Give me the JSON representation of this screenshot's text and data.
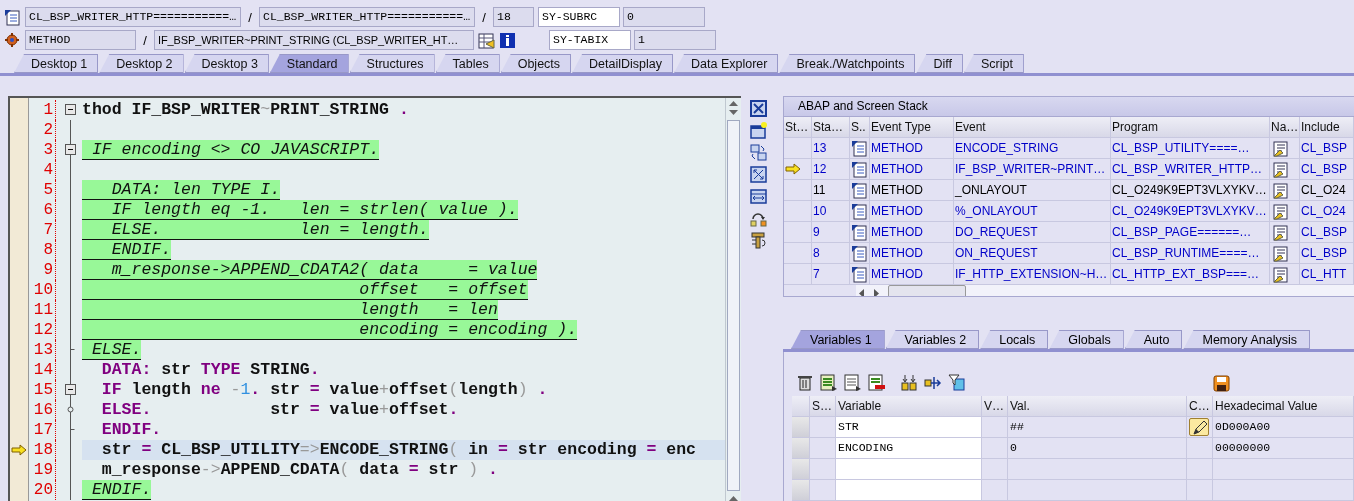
{
  "header": {
    "program": "CL_BSP_WRITER_HTTP===========…",
    "include": "CL_BSP_WRITER_HTTP===========…",
    "line": "18",
    "event_type": "METHOD",
    "event": "IF_BSP_WRITER~PRINT_STRING (CL_BSP_WRITER_HT…",
    "separators": [
      "/",
      "/",
      "/"
    ],
    "sy_fields": [
      {
        "name": "SY-SUBRC",
        "value": "0"
      },
      {
        "name": "SY-TABIX",
        "value": "1"
      }
    ]
  },
  "tabs": [
    {
      "label": "Desktop 1",
      "selected": false
    },
    {
      "label": "Desktop 2",
      "selected": false
    },
    {
      "label": "Desktop 3",
      "selected": false
    },
    {
      "label": "Standard",
      "selected": true
    },
    {
      "label": "Structures",
      "selected": false
    },
    {
      "label": "Tables",
      "selected": false
    },
    {
      "label": "Objects",
      "selected": false
    },
    {
      "label": "DetailDisplay",
      "selected": false
    },
    {
      "label": "Data Explorer",
      "selected": false
    },
    {
      "label": "Break./Watchpoints",
      "selected": false
    },
    {
      "label": "Diff",
      "selected": false
    },
    {
      "label": "Script",
      "selected": false
    }
  ],
  "editor": {
    "lines": [
      {
        "number": "1",
        "marker": {
          "kind": "toggle"
        },
        "highlight": false,
        "current": false,
        "segments": [
          {
            "text": "thod IF_BSP_WRITER",
            "kind": "plain"
          },
          {
            "text": "~",
            "kind": "operator"
          },
          {
            "text": "PRINT_STRING ",
            "kind": "plain"
          },
          {
            "text": ".",
            "kind": "punct"
          }
        ]
      },
      {
        "number": "2"
      },
      {
        "number": "3",
        "marker": {
          "kind": "toggle"
        },
        "highlight": true,
        "current": false,
        "segments": [
          {
            "text": " IF encoding <> CO JAVASCRIPT.",
            "kind": "plain"
          }
        ]
      },
      {
        "number": "4"
      },
      {
        "number": "5",
        "highlight": true,
        "current": false,
        "segments": [
          {
            "text": "   DATA: len TYPE I.",
            "kind": "plain"
          }
        ]
      },
      {
        "number": "6",
        "highlight": true,
        "current": false,
        "segments": [
          {
            "text": "   IF length eq -1.   len = strlen( value ).",
            "kind": "plain"
          }
        ]
      },
      {
        "number": "7",
        "highlight": true,
        "current": false,
        "segments": [
          {
            "text": "   ELSE.              len = length.",
            "kind": "plain"
          }
        ]
      },
      {
        "number": "8",
        "highlight": true,
        "current": false,
        "segments": [
          {
            "text": "   ENDIF.",
            "kind": "plain"
          }
        ]
      },
      {
        "number": "9",
        "highlight": true,
        "current": false,
        "segments": [
          {
            "text": "   m_response->APPEND_CDATA2( data     = value",
            "kind": "plain"
          }
        ]
      },
      {
        "number": "10",
        "highlight": true,
        "current": false,
        "segments": [
          {
            "text": "                            offset   = offset",
            "kind": "plain"
          }
        ]
      },
      {
        "number": "11",
        "highlight": true,
        "current": false,
        "segments": [
          {
            "text": "                            length   = len",
            "kind": "plain"
          }
        ]
      },
      {
        "number": "12",
        "highlight": true,
        "current": false,
        "segments": [
          {
            "text": "                            encoding = encoding ).",
            "kind": "plain"
          }
        ]
      },
      {
        "number": "13",
        "marker": {
          "kind": "end"
        },
        "highlight": true,
        "current": false,
        "segments": [
          {
            "text": " ELSE.",
            "kind": "plain"
          }
        ]
      },
      {
        "number": "14",
        "highlight": false,
        "current": false,
        "segments": [
          {
            "text": "  DATA:",
            "kind": "keyword"
          },
          {
            "text": " str ",
            "kind": "plain"
          },
          {
            "text": "TYPE",
            "kind": "keyword"
          },
          {
            "text": " STRING",
            "kind": "plain"
          },
          {
            "text": ".",
            "kind": "punct"
          }
        ]
      },
      {
        "number": "15",
        "marker": {
          "kind": "toggle"
        },
        "highlight": false,
        "current": false,
        "segments": [
          {
            "text": "  IF",
            "kind": "keyword"
          },
          {
            "text": " length ",
            "kind": "plain"
          },
          {
            "text": "ne",
            "kind": "keyword"
          },
          {
            "text": " -",
            "kind": "operator"
          },
          {
            "text": "1",
            "kind": "number"
          },
          {
            "text": ".",
            "kind": "punct"
          },
          {
            "text": " str ",
            "kind": "plain"
          },
          {
            "text": "=",
            "kind": "punct"
          },
          {
            "text": " value",
            "kind": "plain"
          },
          {
            "text": "+",
            "kind": "operator"
          },
          {
            "text": "offset",
            "kind": "plain"
          },
          {
            "text": "(",
            "kind": "operator"
          },
          {
            "text": "length",
            "kind": "plain"
          },
          {
            "text": ")",
            "kind": "operator"
          },
          {
            "text": " .",
            "kind": "punct"
          }
        ]
      },
      {
        "number": "16",
        "marker": {
          "kind": "branch"
        },
        "highlight": false,
        "current": false,
        "segments": [
          {
            "text": "  ELSE",
            "kind": "keyword"
          },
          {
            "text": ".",
            "kind": "punct"
          },
          {
            "text": "            str ",
            "kind": "plain"
          },
          {
            "text": "=",
            "kind": "punct"
          },
          {
            "text": " value",
            "kind": "plain"
          },
          {
            "text": "+",
            "kind": "operator"
          },
          {
            "text": "offset",
            "kind": "plain"
          },
          {
            "text": ".",
            "kind": "punct"
          }
        ]
      },
      {
        "number": "17",
        "marker": {
          "kind": "end"
        },
        "highlight": false,
        "current": false,
        "segments": [
          {
            "text": "  ENDIF",
            "kind": "keyword"
          },
          {
            "text": ".",
            "kind": "punct"
          }
        ]
      },
      {
        "number": "18",
        "highlight": false,
        "current": true,
        "segments": [
          {
            "text": "  str ",
            "kind": "plain"
          },
          {
            "text": "=",
            "kind": "punct"
          },
          {
            "text": " CL_BSP_UTILITY",
            "kind": "plain"
          },
          {
            "text": "=>",
            "kind": "operator"
          },
          {
            "text": "ENCODE_STRING",
            "kind": "plain"
          },
          {
            "text": "(",
            "kind": "operator"
          },
          {
            "text": " in ",
            "kind": "plain"
          },
          {
            "text": "=",
            "kind": "punct"
          },
          {
            "text": " str encoding ",
            "kind": "plain"
          },
          {
            "text": "=",
            "kind": "punct"
          },
          {
            "text": " enc",
            "kind": "plain"
          }
        ]
      },
      {
        "number": "19",
        "highlight": false,
        "current": false,
        "segments": [
          {
            "text": "  m_response",
            "kind": "plain"
          },
          {
            "text": "->",
            "kind": "operator"
          },
          {
            "text": "APPEND_CDATA",
            "kind": "plain"
          },
          {
            "text": "(",
            "kind": "operator"
          },
          {
            "text": " data ",
            "kind": "plain"
          },
          {
            "text": "=",
            "kind": "punct"
          },
          {
            "text": " str ",
            "kind": "plain"
          },
          {
            "text": ")",
            "kind": "operator"
          },
          {
            "text": " .",
            "kind": "punct"
          }
        ]
      },
      {
        "number": "20",
        "highlight": true,
        "current": false,
        "segments": [
          {
            "text": " ENDIF.",
            "kind": "plain"
          }
        ]
      }
    ]
  },
  "stack": {
    "title": "ABAP and Screen Stack",
    "columns": [
      "St…",
      "Sta…",
      "S..",
      "Event Type",
      "Event",
      "Program",
      "Na…",
      "Include"
    ],
    "rows": [
      {
        "current": false,
        "number": "13",
        "event_type": "METHOD",
        "event": "ENCODE_STRING",
        "program": "CL_BSP_UTILITY====…",
        "include": "CL_BSP",
        "color": "#0000c8"
      },
      {
        "current": true,
        "number": "12",
        "event_type": "METHOD",
        "event": "IF_BSP_WRITER~PRINT…",
        "program": "CL_BSP_WRITER_HTTP…",
        "include": "CL_BSP",
        "color": "#0000c8"
      },
      {
        "current": false,
        "number": "11",
        "event_type": "METHOD",
        "event": "_ONLAYOUT",
        "program": "CL_O249K9EPT3VLXYKV…",
        "include": "CL_O24",
        "color": "#000000"
      },
      {
        "current": false,
        "number": "10",
        "event_type": "METHOD",
        "event": "%_ONLAYOUT",
        "program": "CL_O249K9EPT3VLXYKV…",
        "include": "CL_O24",
        "color": "#0000c8"
      },
      {
        "current": false,
        "number": "9",
        "event_type": "METHOD",
        "event": "DO_REQUEST",
        "program": "CL_BSP_PAGE======…",
        "include": "CL_BSP",
        "color": "#0000c8"
      },
      {
        "current": false,
        "number": "8",
        "event_type": "METHOD",
        "event": "ON_REQUEST",
        "program": "CL_BSP_RUNTIME====…",
        "include": "CL_BSP",
        "color": "#0000c8"
      },
      {
        "current": false,
        "number": "7",
        "event_type": "METHOD",
        "event": "IF_HTTP_EXTENSION~H…",
        "program": "CL_HTTP_EXT_BSP===…",
        "include": "CL_HTT",
        "color": "#0000c8"
      }
    ]
  },
  "variables": {
    "tabs": [
      {
        "label": "Variables 1",
        "selected": true
      },
      {
        "label": "Variables 2",
        "selected": false
      },
      {
        "label": "Locals",
        "selected": false
      },
      {
        "label": "Globals",
        "selected": false
      },
      {
        "label": "Auto",
        "selected": false
      },
      {
        "label": "Memory Analysis",
        "selected": false
      }
    ],
    "columns": [
      "S…",
      "Variable",
      "V…",
      "Val.",
      "C…",
      "Hexadecimal Value"
    ],
    "rows": [
      {
        "variable": "STR",
        "value": "##",
        "changeable": true,
        "hex": "0D000A00"
      },
      {
        "variable": "ENCODING",
        "value": "0",
        "changeable": false,
        "hex": "00000000"
      }
    ]
  }
}
